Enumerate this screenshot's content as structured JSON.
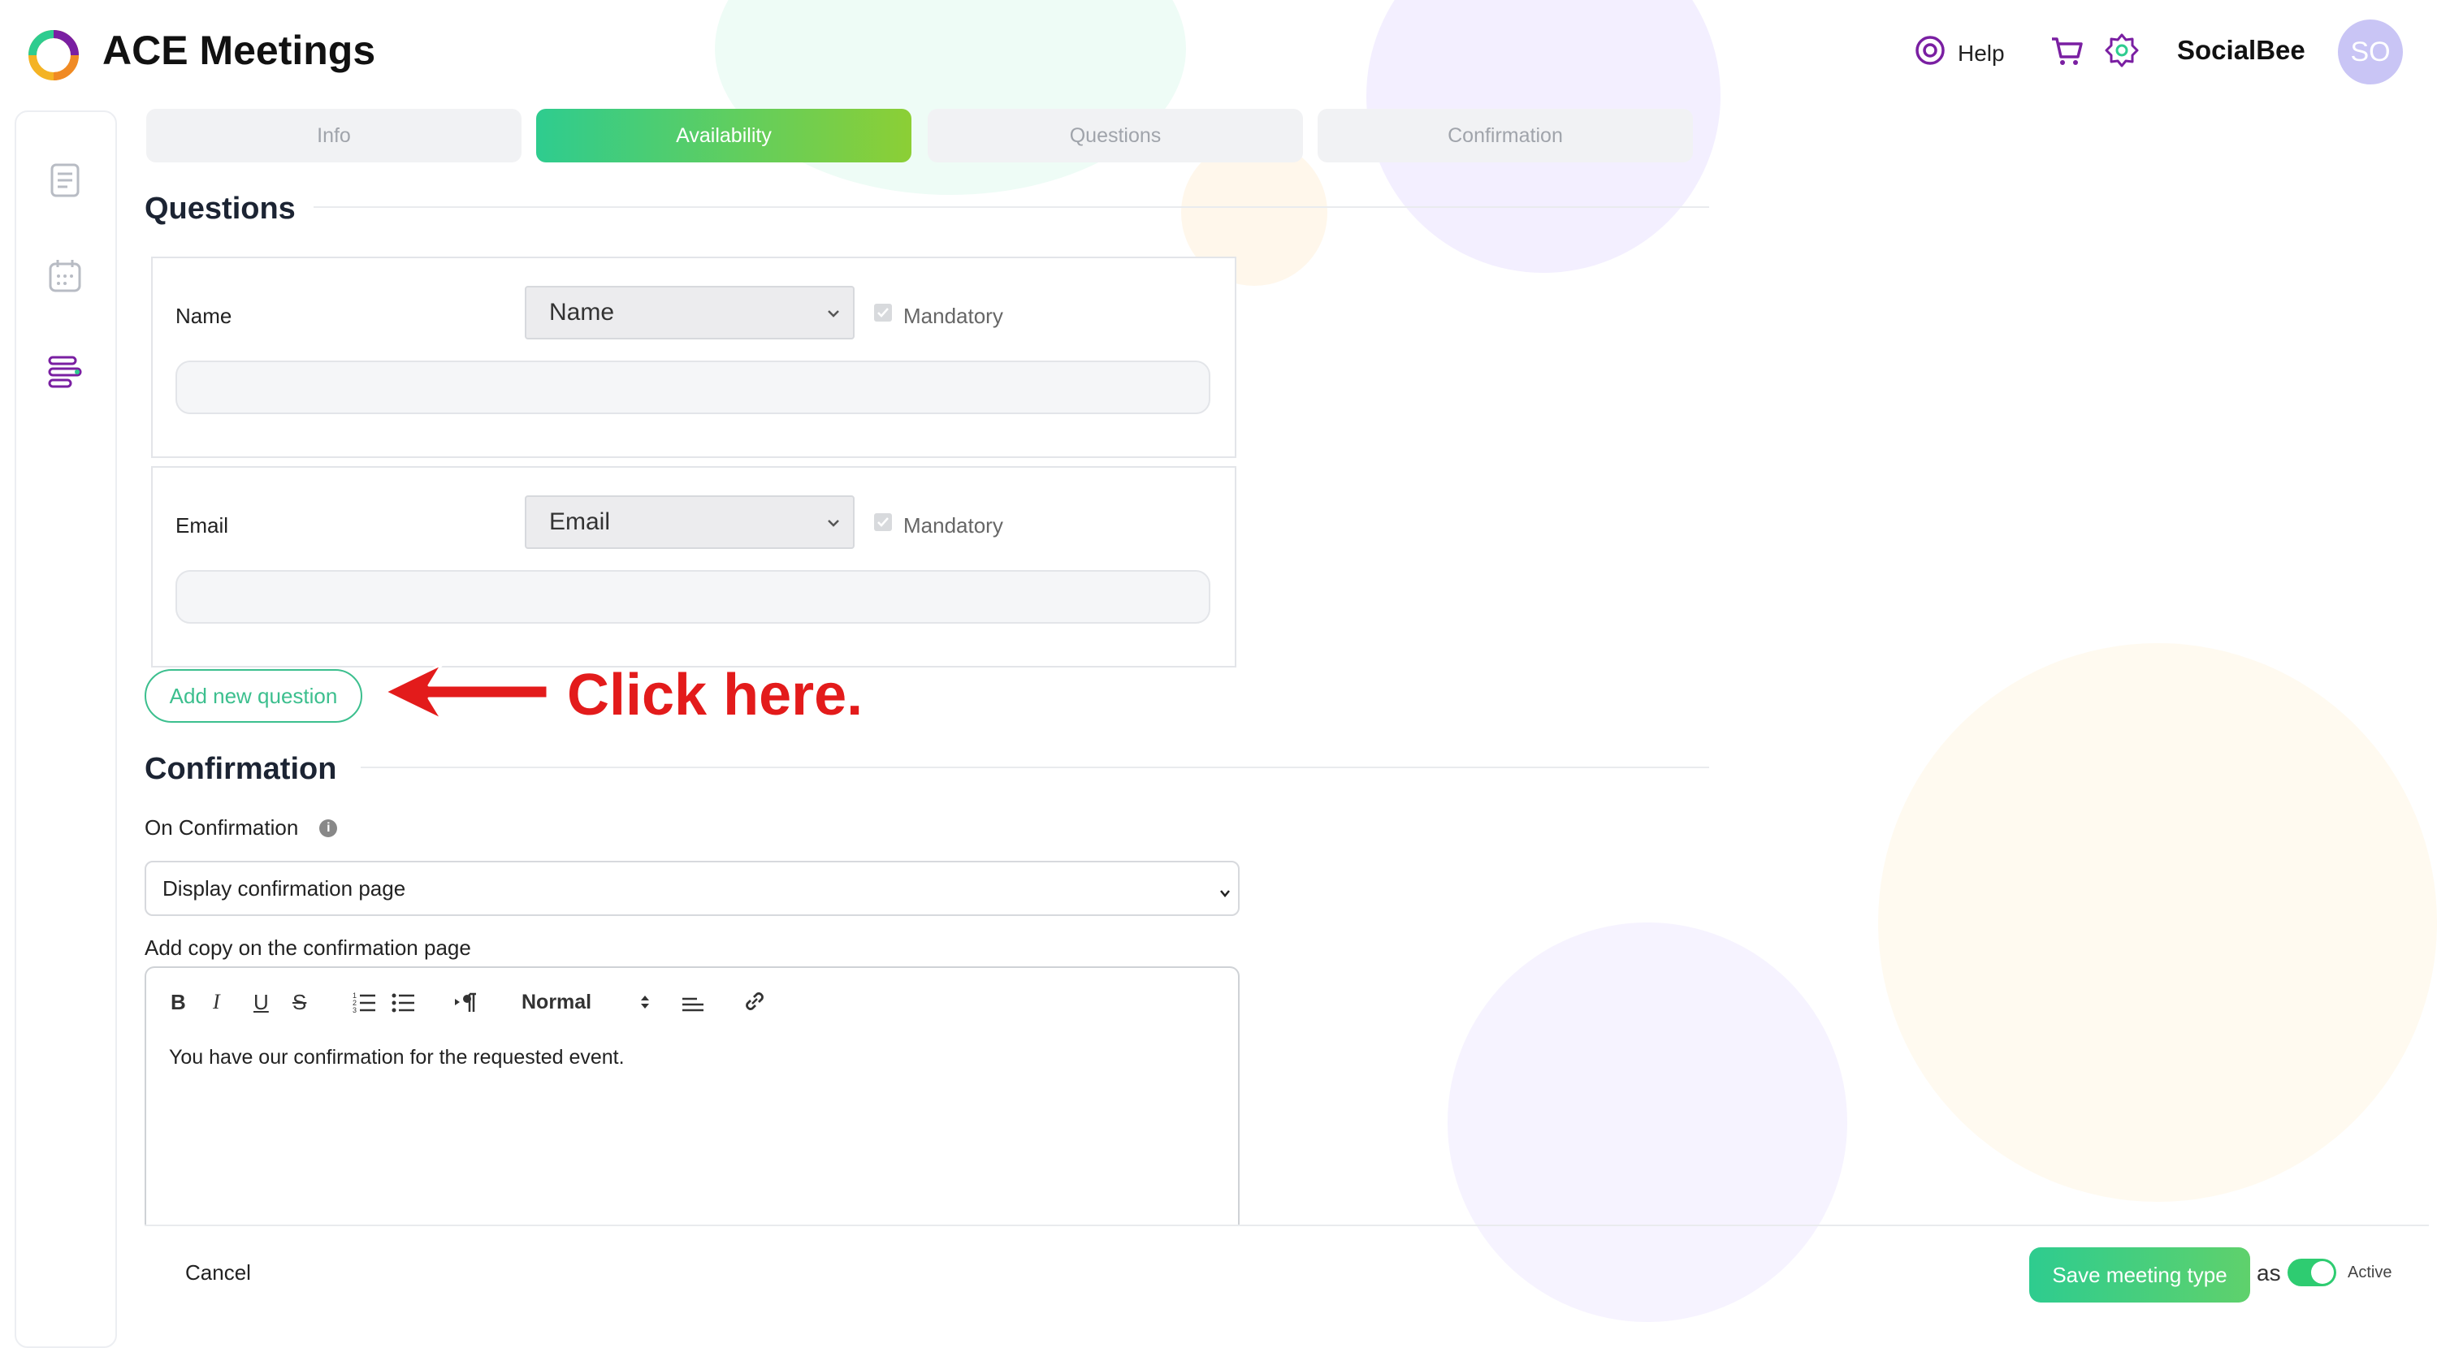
{
  "header": {
    "app_title": "ACE Meetings",
    "help_label": "Help",
    "username": "SocialBee",
    "avatar_initials": "SO"
  },
  "steps": [
    {
      "label": "Info",
      "active": false
    },
    {
      "label": "Availability",
      "active": true
    },
    {
      "label": "Questions",
      "active": false
    },
    {
      "label": "Confirmation",
      "active": false
    }
  ],
  "questions_section": {
    "title": "Questions",
    "items": [
      {
        "label": "Name",
        "type_value": "Name",
        "mandatory_label": "Mandatory",
        "mandatory_checked": true
      },
      {
        "label": "Email",
        "type_value": "Email",
        "mandatory_label": "Mandatory",
        "mandatory_checked": true
      }
    ],
    "add_button": "Add new question"
  },
  "annotation": "Click here.",
  "confirmation_section": {
    "title": "Confirmation",
    "on_confirmation_label": "On Confirmation",
    "on_confirmation_value": "Display confirmation page",
    "copy_label": "Add copy on the confirmation page",
    "editor": {
      "toolbar_bold": "B",
      "toolbar_italic": "I",
      "toolbar_underline": "U",
      "toolbar_strike": "S",
      "heading_value": "Normal",
      "content": "You have our confirmation for the requested event."
    }
  },
  "footer": {
    "cancel_label": "Cancel",
    "save_label": "Save meeting type",
    "as_label": "as",
    "status_label": "Active",
    "status_on": true
  },
  "colors": {
    "accent_green": "#2ecc8f",
    "accent_lime": "#8ccf35",
    "brand_purple": "#7a1fa2",
    "annotation_red": "#e31b1b"
  },
  "icons": [
    "logo-icon",
    "help-icon",
    "cart-icon",
    "gear-icon",
    "document-icon",
    "calendar-icon",
    "questions-list-icon",
    "info-icon",
    "bold-icon",
    "italic-icon",
    "underline-icon",
    "strikethrough-icon",
    "ordered-list-icon",
    "bullet-list-icon",
    "text-direction-icon",
    "align-icon",
    "link-icon"
  ]
}
